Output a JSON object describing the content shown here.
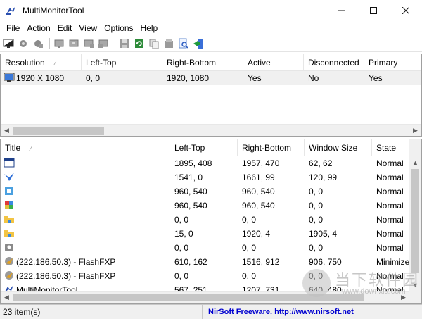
{
  "window": {
    "title": "MultiMonitorTool"
  },
  "menu": [
    "File",
    "Action",
    "Edit",
    "View",
    "Options",
    "Help"
  ],
  "toolbar_icons": [
    "monitor-icon",
    "gear-icon",
    "gear-icon",
    "monitor-icon",
    "monitor-icon",
    "monitor-icon",
    "monitor-icon",
    "save-icon",
    "refresh-icon",
    "copy-icon",
    "properties-icon",
    "find-icon",
    "exit-icon"
  ],
  "monitors": {
    "columns": [
      "Resolution",
      "Left-Top",
      "Right-Bottom",
      "Active",
      "Disconnected",
      "Primary"
    ],
    "rows": [
      {
        "icon": "monitor-icon",
        "resolution": "1920 X 1080",
        "left_top": "0, 0",
        "right_bottom": "1920, 1080",
        "active": "Yes",
        "disconnected": "No",
        "primary": "Yes"
      }
    ]
  },
  "windows": {
    "columns": [
      "Title",
      "Left-Top",
      "Right-Bottom",
      "Window Size",
      "State"
    ],
    "rows": [
      {
        "icon": "window-icon",
        "title": "",
        "left_top": "1895, 408",
        "right_bottom": "1957, 470",
        "size": "62, 62",
        "state": "Normal"
      },
      {
        "icon": "bird-icon",
        "title": "",
        "left_top": "1541, 0",
        "right_bottom": "1661, 99",
        "size": "120, 99",
        "state": "Normal"
      },
      {
        "icon": "app-icon",
        "title": "",
        "left_top": "960, 540",
        "right_bottom": "960, 540",
        "size": "0, 0",
        "state": "Normal"
      },
      {
        "icon": "colorful-icon",
        "title": "",
        "left_top": "960, 540",
        "right_bottom": "960, 540",
        "size": "0, 0",
        "state": "Normal"
      },
      {
        "icon": "folder-icon",
        "title": "",
        "left_top": "0, 0",
        "right_bottom": "0, 0",
        "size": "0, 0",
        "state": "Normal"
      },
      {
        "icon": "folder-icon",
        "title": "",
        "left_top": "15, 0",
        "right_bottom": "1920, 4",
        "size": "1905, 4",
        "state": "Normal"
      },
      {
        "icon": "disk-icon",
        "title": "",
        "left_top": "0, 0",
        "right_bottom": "0, 0",
        "size": "0, 0",
        "state": "Normal"
      },
      {
        "icon": "flashfxp-icon",
        "title": "(222.186.50.3) - FlashFXP",
        "left_top": "610, 162",
        "right_bottom": "1516, 912",
        "size": "906, 750",
        "state": "Minimize"
      },
      {
        "icon": "flashfxp-icon",
        "title": "(222.186.50.3) - FlashFXP",
        "left_top": "0, 0",
        "right_bottom": "0, 0",
        "size": "0, 0",
        "state": "Normal"
      },
      {
        "icon": "multimonitor-icon",
        "title": "MultiMonitorTool",
        "left_top": "567, 251",
        "right_bottom": "1207, 731",
        "size": "640, 480",
        "state": "Normal"
      }
    ]
  },
  "status": {
    "count": "23 item(s)",
    "link": "NirSoft Freeware.  http://www.nirsoft.net"
  },
  "watermark": {
    "text": "当下软件园",
    "url": "www.downxia.com"
  }
}
